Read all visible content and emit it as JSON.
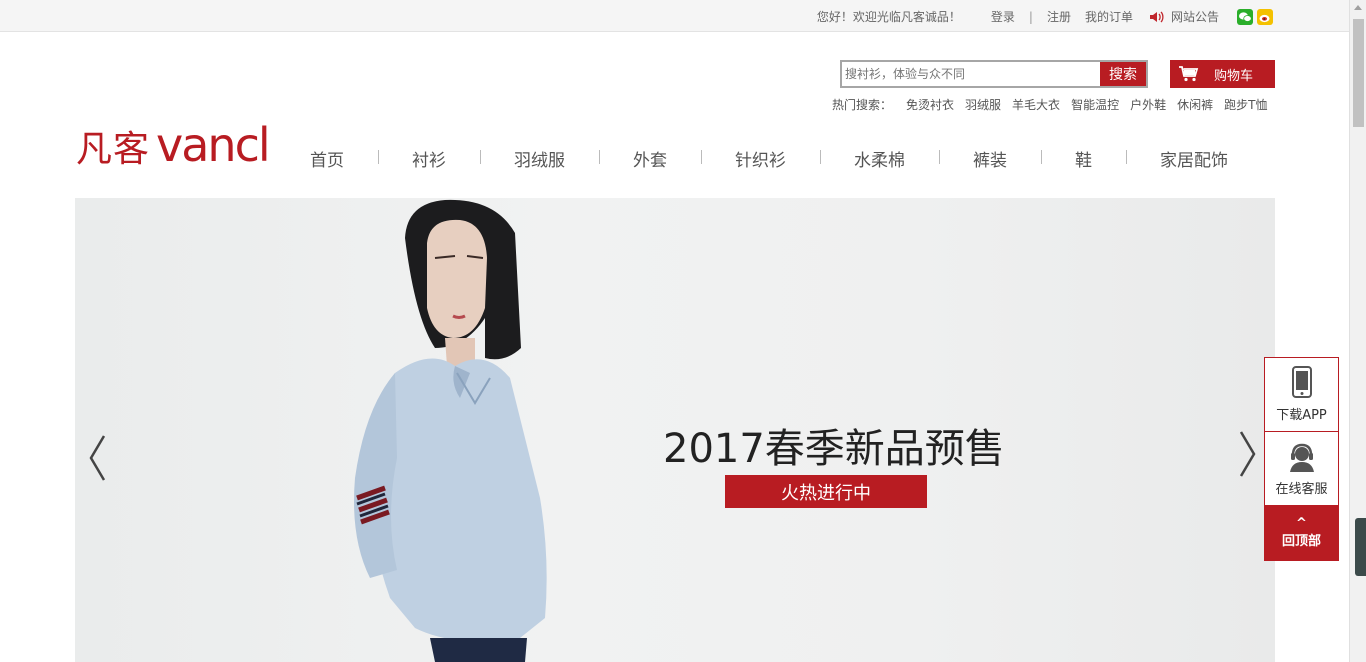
{
  "topbar": {
    "welcome": "您好！欢迎光临凡客诚品！",
    "login": "登录",
    "divider": "|",
    "register": "注册",
    "orders": "我的订单",
    "notice": "网站公告"
  },
  "search": {
    "placeholder": "搜衬衫，体验与众不同",
    "button": "搜索"
  },
  "cart": {
    "label": "购物车"
  },
  "hot": {
    "label": "热门搜索：",
    "items": [
      "免烫衬衣",
      "羽绒服",
      "羊毛大衣",
      "智能温控",
      "户外鞋",
      "休闲裤",
      "跑步T恤"
    ]
  },
  "logo": {
    "cn": "凡客",
    "en": "vancl"
  },
  "nav": {
    "items": [
      "首页",
      "衬衫",
      "羽绒服",
      "外套",
      "针织衫",
      "水柔棉",
      "裤装",
      "鞋",
      "家居配饰"
    ]
  },
  "banner": {
    "headline": "2017春季新品预售",
    "cta": "火热进行中"
  },
  "float": {
    "app": "下载APP",
    "service": "在线客服",
    "top_caret": "^",
    "top": "回顶部"
  },
  "colors": {
    "brand": "#b81c22"
  }
}
